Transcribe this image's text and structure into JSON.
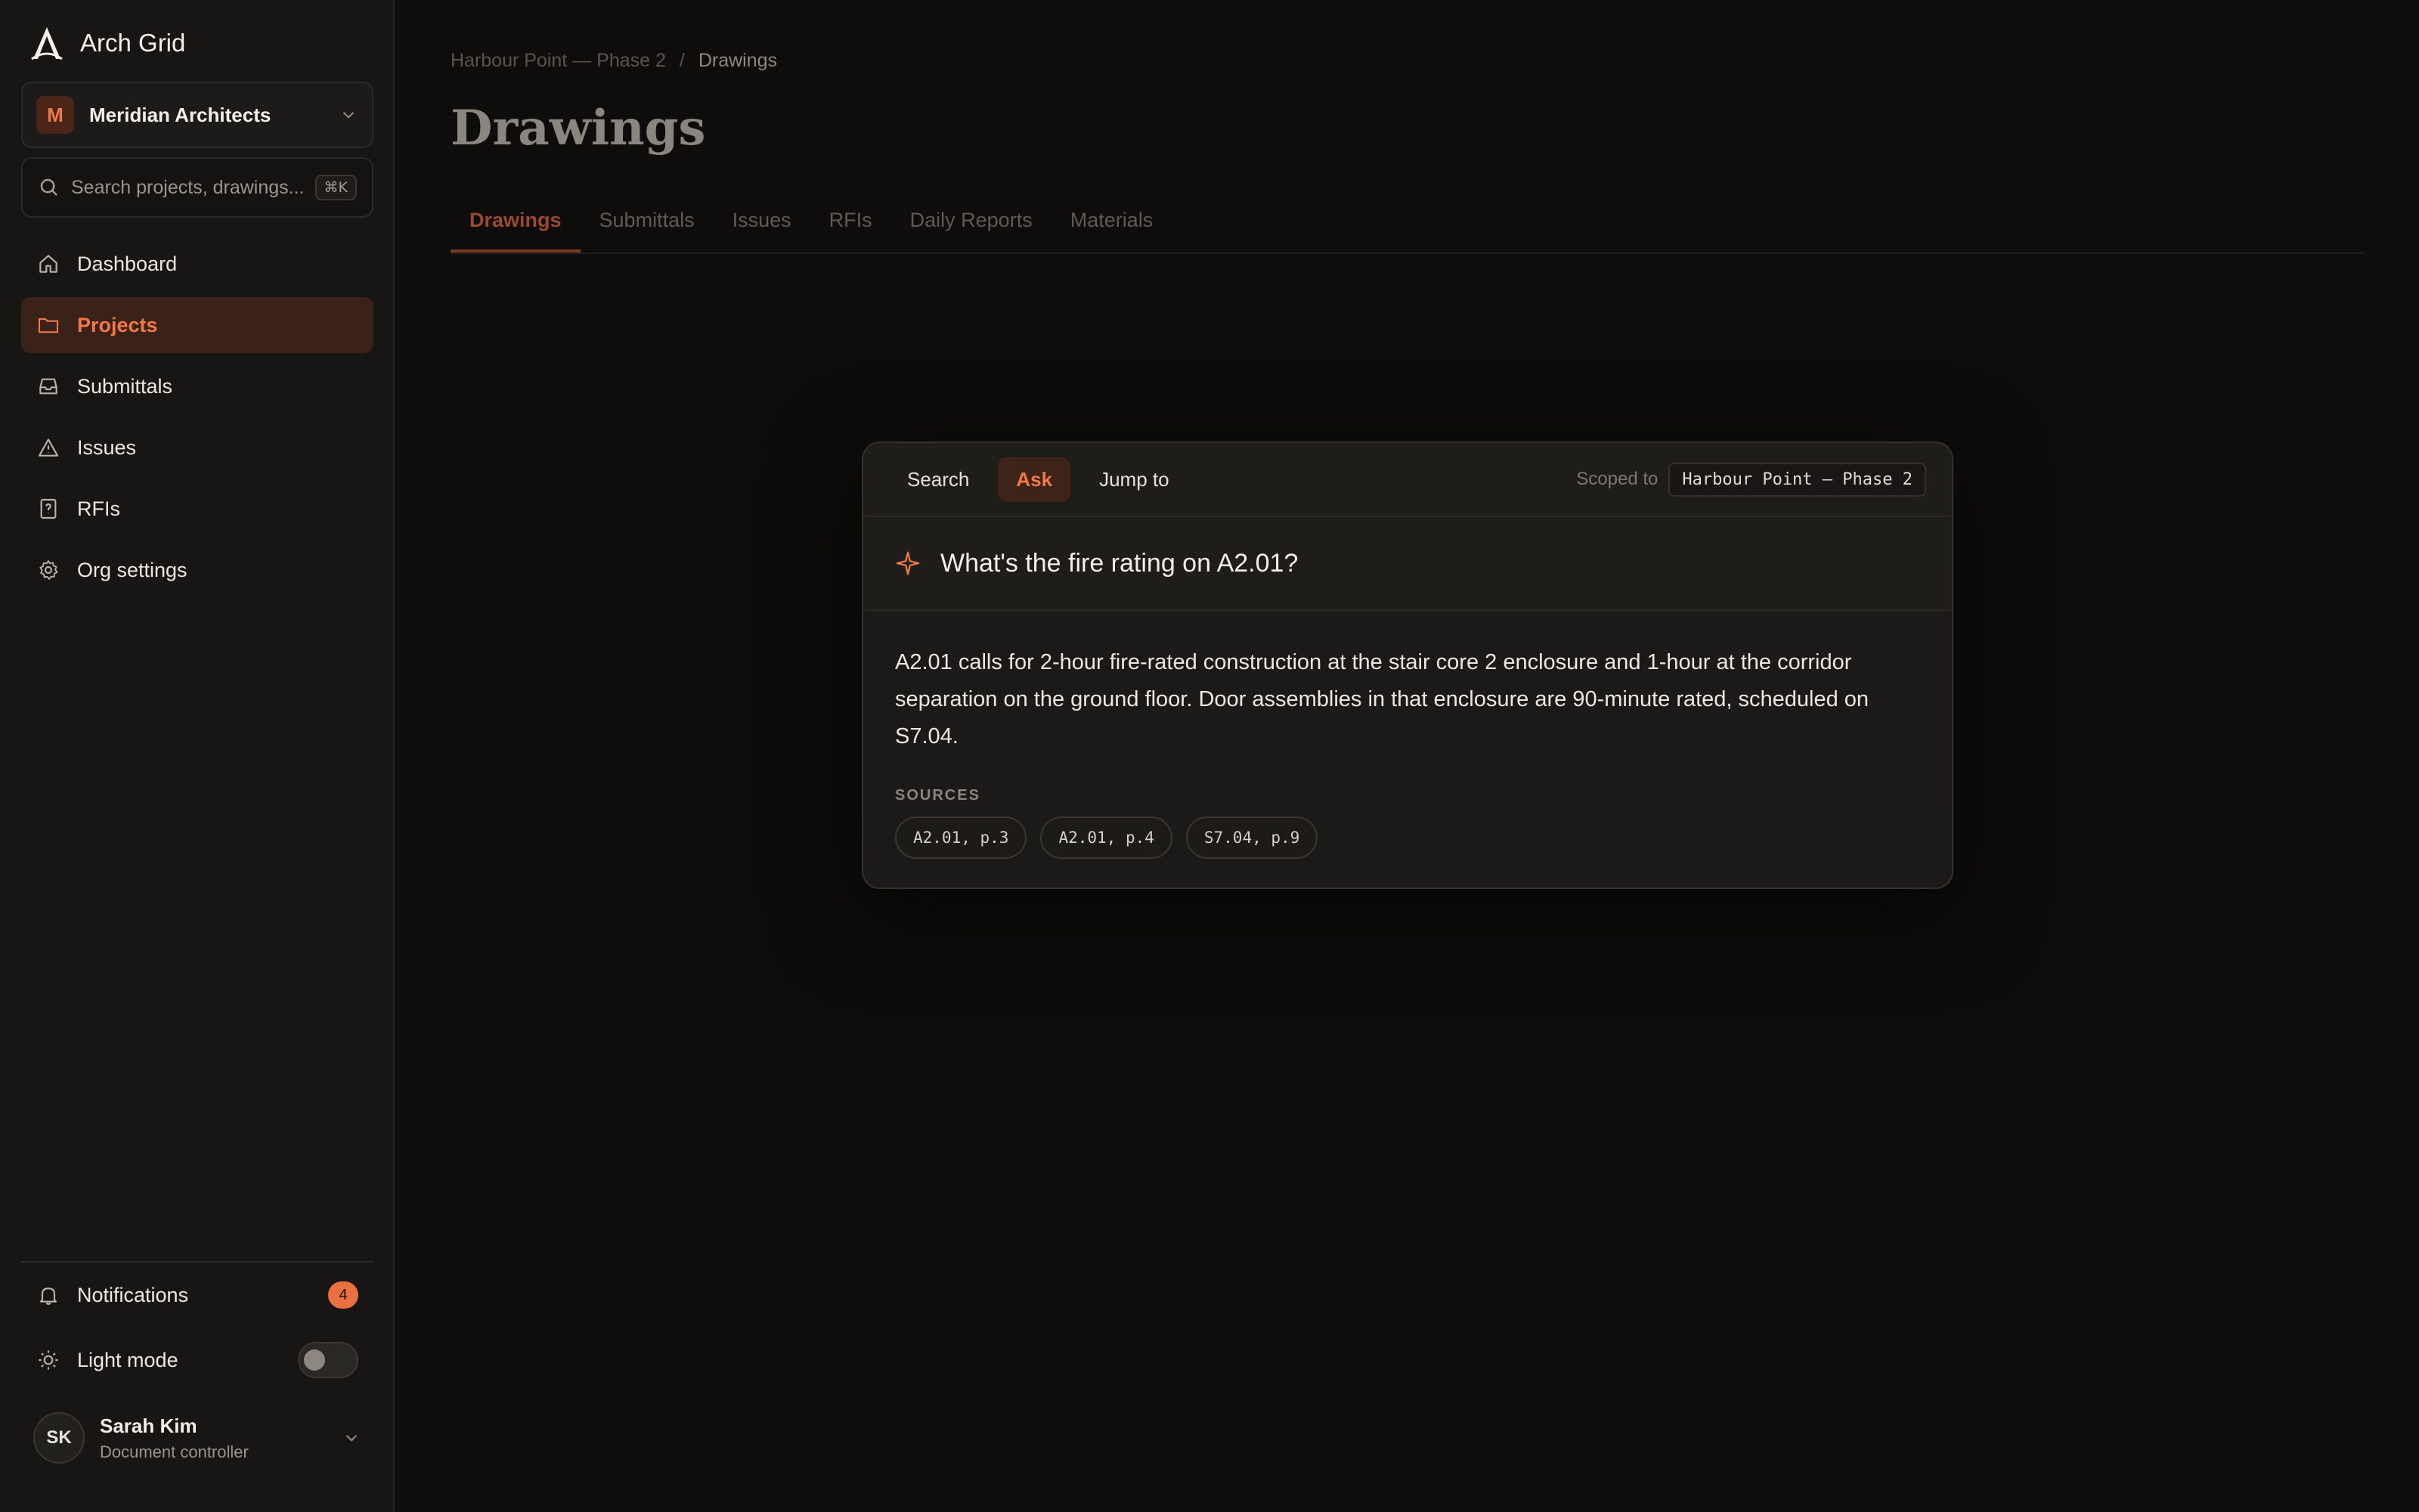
{
  "app": {
    "name": "Arch Grid"
  },
  "org": {
    "initial": "M",
    "name": "Meridian Architects"
  },
  "search": {
    "placeholder": "Search projects, drawings...",
    "shortcut": "⌘K"
  },
  "nav": [
    {
      "label": "Dashboard",
      "icon": "home-icon",
      "active": false
    },
    {
      "label": "Projects",
      "icon": "folder-icon",
      "active": true
    },
    {
      "label": "Submittals",
      "icon": "inbox-icon",
      "active": false
    },
    {
      "label": "Issues",
      "icon": "warning-icon",
      "active": false
    },
    {
      "label": "RFIs",
      "icon": "question-icon",
      "active": false
    },
    {
      "label": "Org settings",
      "icon": "gear-icon",
      "active": false
    }
  ],
  "notifications": {
    "label": "Notifications",
    "count": "4"
  },
  "theme": {
    "label": "Light mode",
    "enabled": false
  },
  "user": {
    "initials": "SK",
    "name": "Sarah Kim",
    "role": "Document controller"
  },
  "breadcrumb": {
    "project": "Harbour Point — Phase 2",
    "separator": "/",
    "current": "Drawings"
  },
  "page": {
    "title": "Drawings"
  },
  "tabs": [
    "Drawings",
    "Submittals",
    "Issues",
    "RFIs",
    "Daily Reports",
    "Materials"
  ],
  "active_tab": "Drawings",
  "palette": {
    "modes": [
      "Search",
      "Ask",
      "Jump to"
    ],
    "active_mode": "Ask",
    "scope_label": "Scoped to",
    "scope_value": "Harbour Point — Phase 2",
    "question": "What's the fire rating on A2.01?",
    "answer": "A2.01 calls for 2-hour fire-rated construction at the stair core 2 enclosure and 1-hour at the corridor separation on the ground floor. Door assemblies in that enclosure are 90-minute rated, scheduled on S7.04.",
    "sources_label": "SOURCES",
    "sources": [
      "A2.01, p.3",
      "A2.01, p.4",
      "S7.04, p.9"
    ]
  },
  "colors": {
    "accent": "#ef7a45",
    "background": "#0e0d0c",
    "sidebar": "#171614"
  }
}
